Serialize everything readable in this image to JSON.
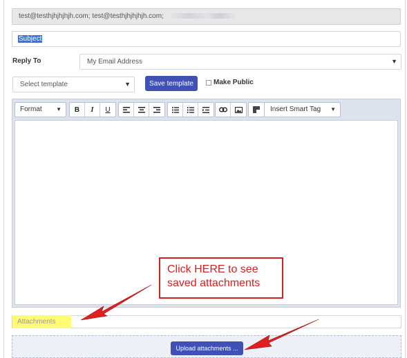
{
  "compose": {
    "to_value": "test@testhjhjhjhjh.com; test@testhjhjhjhjh.com;",
    "subject_value": "Subject",
    "reply_to_label": "Reply To",
    "reply_to_value": "My Email Address",
    "template_placeholder": "Select template",
    "save_template_label": "Save template",
    "make_public_label": "Make Public",
    "attachments_placeholder": "Attachments",
    "upload_label": "Upload attachments ..."
  },
  "toolbar": {
    "format_label": "Format",
    "bold": "B",
    "italic": "I",
    "underline": "U",
    "insert_tag_label": "Insert Smart Tag"
  },
  "annotation": {
    "callout_text": "Click HERE to see saved attachments",
    "color": "#d42020"
  },
  "colors": {
    "primary_button": "#3f51b5",
    "highlight": "#fffb74",
    "selection": "#3874d8"
  }
}
